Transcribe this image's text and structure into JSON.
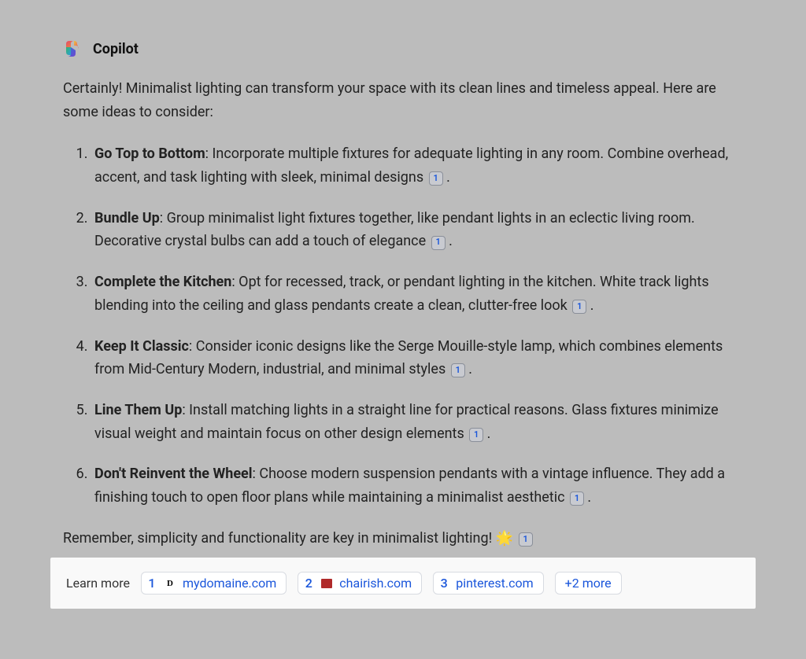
{
  "header": {
    "title": "Copilot"
  },
  "message": {
    "intro": "Certainly! Minimalist lighting can transform your space with its clean lines and timeless appeal. Here are some ideas to consider:",
    "tips": [
      {
        "title": "Go Top to Bottom",
        "text": ": Incorporate multiple fixtures for adequate lighting in any room. Combine overhead, accent, and task lighting with sleek, minimal designs",
        "cite": "1"
      },
      {
        "title": "Bundle Up",
        "text": ": Group minimalist light fixtures together, like pendant lights in an eclectic living room. Decorative crystal bulbs can add a touch of elegance",
        "cite": "1"
      },
      {
        "title": "Complete the Kitchen",
        "text": ": Opt for recessed, track, or pendant lighting in the kitchen. White track lights blending into the ceiling and glass pendants create a clean, clutter-free look",
        "cite": "1"
      },
      {
        "title": "Keep It Classic",
        "text": ": Consider iconic designs like the Serge Mouille-style lamp, which combines elements from Mid-Century Modern, industrial, and minimal styles",
        "cite": "1"
      },
      {
        "title": "Line Them Up",
        "text": ": Install matching lights in a straight line for practical reasons. Glass fixtures minimize visual weight and maintain focus on other design elements",
        "cite": "1"
      },
      {
        "title": "Don't Reinvent the Wheel",
        "text": ": Choose modern suspension pendants with a vintage influence. They add a finishing touch to open floor plans while maintaining a minimalist aesthetic",
        "cite": "1"
      }
    ],
    "closing_text": "Remember, simplicity and functionality are key in minimalist lighting! ",
    "closing_emoji": "🌟",
    "closing_cite": "1"
  },
  "learn_more": {
    "label": "Learn more",
    "sources": [
      {
        "num": "1",
        "favicon_type": "d",
        "domain": "mydomaine.com"
      },
      {
        "num": "2",
        "favicon_type": "red",
        "domain": "chairish.com"
      },
      {
        "num": "3",
        "favicon_type": "none",
        "domain": "pinterest.com"
      }
    ],
    "more": "+2 more"
  }
}
